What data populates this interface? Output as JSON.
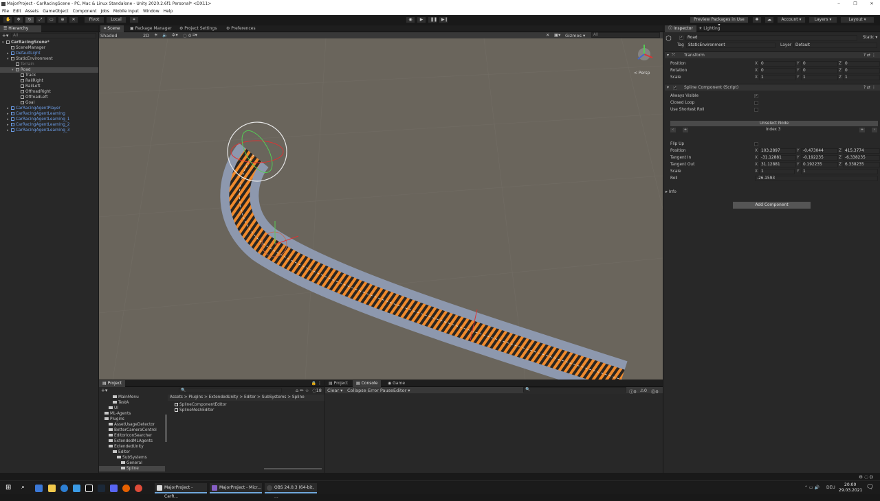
{
  "window": {
    "title": "MajorProject - CarRacingScene - PC, Mac & Linux Standalone - Unity 2020.2.6f1 Personal* <DX11>",
    "controls": [
      "‒",
      "❐",
      "✕"
    ]
  },
  "menu": [
    "File",
    "Edit",
    "Assets",
    "GameObject",
    "Component",
    "Jobs",
    "Mobile Input",
    "Window",
    "Help"
  ],
  "toolbar": {
    "pivot": "Pivot",
    "local": "Local",
    "preview_packages": "Preview Packages in Use ▾",
    "account": "Account ▾",
    "layers": "Layers ▾",
    "layout": "Layout ▾"
  },
  "hierarchy": {
    "tab": "Hierarchy",
    "search_placeholder": "All",
    "items": [
      {
        "label": "CarRacingScene*",
        "depth": 0,
        "kind": "scene"
      },
      {
        "label": "SceneManager",
        "depth": 1,
        "kind": "cube"
      },
      {
        "label": "DefaultLight",
        "depth": 1,
        "kind": "prefab"
      },
      {
        "label": "StaticEnvironment",
        "depth": 1,
        "kind": "cube"
      },
      {
        "label": "Terrain",
        "depth": 2,
        "kind": "dim"
      },
      {
        "label": "Road",
        "depth": 2,
        "kind": "cube",
        "selected": true
      },
      {
        "label": "Track",
        "depth": 3,
        "kind": "cube"
      },
      {
        "label": "RailRight",
        "depth": 3,
        "kind": "cube"
      },
      {
        "label": "RailLeft",
        "depth": 3,
        "kind": "cube"
      },
      {
        "label": "OffroadRight",
        "depth": 3,
        "kind": "cube"
      },
      {
        "label": "OffroadLeft",
        "depth": 3,
        "kind": "cube"
      },
      {
        "label": "Goal",
        "depth": 3,
        "kind": "cube"
      },
      {
        "label": "CarRacingAgentPlayer",
        "depth": 1,
        "kind": "prefab"
      },
      {
        "label": "CarRacingAgentLearning",
        "depth": 1,
        "kind": "prefab"
      },
      {
        "label": "CarRacingAgentLearning_1",
        "depth": 1,
        "kind": "prefab"
      },
      {
        "label": "CarRacingAgentLearning_2",
        "depth": 1,
        "kind": "prefab"
      },
      {
        "label": "CarRacingAgentLearning_3",
        "depth": 1,
        "kind": "prefab"
      }
    ]
  },
  "scene": {
    "tabs": [
      "Scene",
      "Package Manager",
      "Project Settings",
      "Preferences"
    ],
    "shading": "Shaded",
    "mode_2d": "2D",
    "gizmos": "Gizmos ▾",
    "search_placeholder": "All",
    "persp": "< Persp",
    "fx_count": "0"
  },
  "inspector": {
    "tabs": [
      "Inspector",
      "Lighting"
    ],
    "object_name": "Road",
    "static": "Static ▾",
    "tag_label": "Tag",
    "tag_value": "StaticEnvironment",
    "layer_label": "Layer",
    "layer_value": "Default",
    "transform": {
      "title": "Transform",
      "rows": [
        {
          "label": "Position",
          "x": "0",
          "y": "0",
          "z": "0"
        },
        {
          "label": "Rotation",
          "x": "0",
          "y": "0",
          "z": "0"
        },
        {
          "label": "Scale",
          "x": "1",
          "y": "1",
          "z": "1"
        }
      ]
    },
    "spline": {
      "title": "Spline Component (Script)",
      "always_visible": "Always Visible",
      "closed_loop": "Closed Loop",
      "shortest_roll": "Use Shortest Roll",
      "unselect_node": "Unselect Node",
      "index": "Index 3",
      "flip_up": "Flip Up",
      "rows": [
        {
          "label": "Position",
          "x": "103.2897",
          "y": "-0.473044",
          "z": "415.3774"
        },
        {
          "label": "Tangent In",
          "x": "-31.12881",
          "y": "-0.192235",
          "z": "-6.338235"
        },
        {
          "label": "Tangent Out",
          "x": "31.12881",
          "y": "0.192235",
          "z": "6.338235"
        }
      ],
      "scale": {
        "label": "Scale",
        "x": "1",
        "y": "1"
      },
      "roll": {
        "label": "Roll",
        "value": "-26.1593"
      }
    },
    "info": "Info",
    "add_component": "Add Component"
  },
  "project": {
    "tab": "Project",
    "tree": [
      {
        "label": "MainMenu",
        "depth": 3
      },
      {
        "label": "TestA",
        "depth": 3
      },
      {
        "label": "UI",
        "depth": 2
      },
      {
        "label": "ML-Agents",
        "depth": 1
      },
      {
        "label": "Plugins",
        "depth": 1
      },
      {
        "label": "AssetUsageDetector",
        "depth": 2
      },
      {
        "label": "BetterCameraControl",
        "depth": 2
      },
      {
        "label": "EditorIconSearcher",
        "depth": 2
      },
      {
        "label": "ExtendedMLAgents",
        "depth": 2
      },
      {
        "label": "ExtendedUnity",
        "depth": 2
      },
      {
        "label": "Editor",
        "depth": 3
      },
      {
        "label": "SubSystems",
        "depth": 4
      },
      {
        "label": "General",
        "depth": 5
      },
      {
        "label": "Spline",
        "depth": 5,
        "selected": true
      }
    ],
    "breadcrumb": "Assets > Plugins > ExtendedUnity > Editor > SubSystems > Spline",
    "files": [
      "SplineComponentEditor",
      "SplineMeshEditor"
    ],
    "badge": "18"
  },
  "console": {
    "tabs": [
      "Project",
      "Console",
      "Game"
    ],
    "buttons": [
      "Clear ▾",
      "Collapse",
      "Error Pause",
      "Editor ▾"
    ],
    "counts": [
      "0",
      "0",
      "0"
    ]
  },
  "taskbar": {
    "apps": [
      "MajorProject - CarR...",
      "MajorProject - Micr...",
      "OBS 24.0.3 (64-bit, ..."
    ],
    "lang": "DEU",
    "time": "20:00",
    "date": "29.03.2021"
  }
}
